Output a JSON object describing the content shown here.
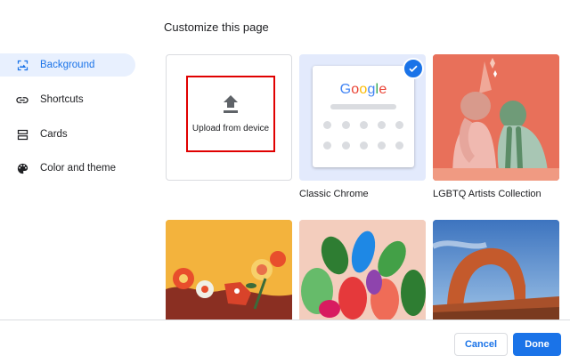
{
  "dialog": {
    "title": "Customize this page"
  },
  "nav": {
    "items": [
      {
        "label": "Background",
        "icon": "image-icon",
        "active": true
      },
      {
        "label": "Shortcuts",
        "icon": "link-icon",
        "active": false
      },
      {
        "label": "Cards",
        "icon": "cards-icon",
        "active": false
      },
      {
        "label": "Color and theme",
        "icon": "palette-icon",
        "active": false
      }
    ]
  },
  "backgrounds": {
    "upload_label": "Upload from device",
    "tiles": [
      {
        "caption": "",
        "kind": "upload"
      },
      {
        "caption": "Classic Chrome",
        "kind": "classic",
        "selected": true
      },
      {
        "caption": "LGBTQ Artists Collection",
        "kind": "art"
      },
      {
        "caption": "",
        "kind": "art"
      },
      {
        "caption": "",
        "kind": "art"
      },
      {
        "caption": "",
        "kind": "photo"
      }
    ],
    "google_logo": "Google"
  },
  "footer": {
    "cancel_label": "Cancel",
    "done_label": "Done"
  },
  "colors": {
    "accent": "#1a73e8",
    "nav_active_bg": "#e8f0fe",
    "highlight_border": "#e00000"
  }
}
